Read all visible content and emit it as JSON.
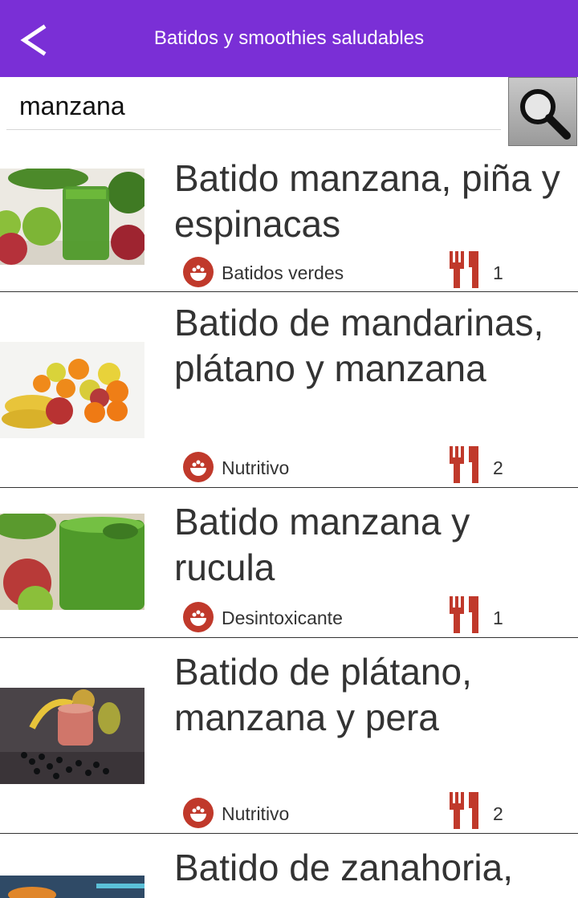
{
  "header": {
    "title": "Batidos y smoothies saludables"
  },
  "search": {
    "value": "manzana"
  },
  "results": [
    {
      "title": "Batido manzana, piña y espinacas",
      "category": "Batidos verdes",
      "servings": "1"
    },
    {
      "title": "Batido de mandarinas, plátano y manzana",
      "category": "Nutritivo",
      "servings": "2"
    },
    {
      "title": "Batido manzana y rucula",
      "category": "Desintoxicante",
      "servings": "1"
    },
    {
      "title": "Batido de plátano, manzana y pera",
      "category": "Nutritivo",
      "servings": "2"
    },
    {
      "title": "Batido de zanahoria,"
    }
  ],
  "colors": {
    "appbar": "#7a2fd6",
    "icon_red": "#c0392b"
  }
}
